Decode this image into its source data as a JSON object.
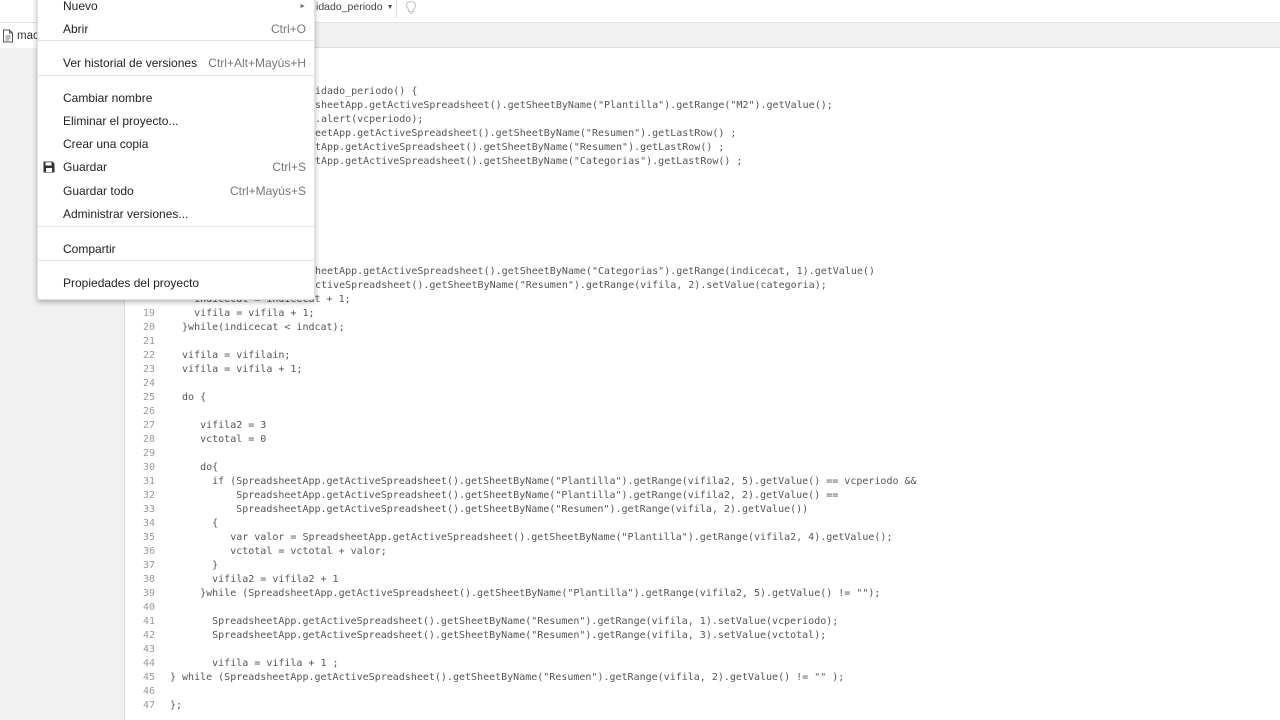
{
  "toolbar": {
    "function_selector": "idado_periodo",
    "bulb_icon": "lightbulb-icon"
  },
  "file_tab": {
    "icon": "document-icon",
    "name": "mac"
  },
  "file_menu": {
    "items": [
      {
        "label": "Nuevo",
        "shortcut": "►"
      },
      {
        "label": "Abrir",
        "shortcut": "Ctrl+O"
      },
      {
        "label": "Ver historial de versiones",
        "shortcut": "Ctrl+Alt+Mayús+H"
      },
      {
        "label": "Cambiar nombre",
        "shortcut": ""
      },
      {
        "label": "Eliminar el proyecto...",
        "shortcut": ""
      },
      {
        "label": "Crear una copia",
        "shortcut": ""
      },
      {
        "label": "Guardar",
        "shortcut": "Ctrl+S",
        "icon": "save-icon"
      },
      {
        "label": "Guardar todo",
        "shortcut": "Ctrl+Mayús+S"
      },
      {
        "label": "Administrar versiones...",
        "shortcut": ""
      },
      {
        "label": "Compartir",
        "shortcut": ""
      },
      {
        "label": "Propiedades del proyecto",
        "shortcut": ""
      }
    ]
  },
  "code_lines": [
    {
      "num": "",
      "text": "idado_periodo() {"
    },
    {
      "num": "",
      "text": "sheetApp.getActiveSpreadsheet().getSheetByName(\"Plantilla\").getRange(\"M2\").getValue();"
    },
    {
      "num": "",
      "text": ".alert(vcperiodo);"
    },
    {
      "num": "",
      "text": "eetApp.getActiveSpreadsheet().getSheetByName(\"Resumen\").getLastRow() ;"
    },
    {
      "num": "",
      "text": "tApp.getActiveSpreadsheet().getSheetByName(\"Resumen\").getLastRow() ;"
    },
    {
      "num": "",
      "text": "tApp.getActiveSpreadsheet().getSheetByName(\"Categorias\").getLastRow() ;"
    },
    {
      "num": "",
      "text": "heetApp.getActiveSpreadsheet().getSheetByName(\"Categorias\").getRange(indicecat, 1).getValue()"
    },
    {
      "num": "",
      "text": "ctiveSpreadsheet().getSheetByName(\"Resumen\").getRange(vifila, 2).setValue(categoria);"
    },
    {
      "num": "",
      "text": "    indicecat = indicecat + 1;"
    },
    {
      "num": "19",
      "text": "    vifila = vifila + 1;"
    },
    {
      "num": "20",
      "text": "  }while(indicecat < indcat);"
    },
    {
      "num": "21",
      "text": ""
    },
    {
      "num": "22",
      "text": "  vifila = vifilain;"
    },
    {
      "num": "23",
      "text": "  vifila = vifila + 1;"
    },
    {
      "num": "24",
      "text": ""
    },
    {
      "num": "25",
      "text": "  do {"
    },
    {
      "num": "26",
      "text": ""
    },
    {
      "num": "27",
      "text": "     vifila2 = 3"
    },
    {
      "num": "28",
      "text": "     vctotal = 0"
    },
    {
      "num": "29",
      "text": ""
    },
    {
      "num": "30",
      "text": "     do{"
    },
    {
      "num": "31",
      "text": "       if (SpreadsheetApp.getActiveSpreadsheet().getSheetByName(\"Plantilla\").getRange(vifila2, 5).getValue() == vcperiodo &&"
    },
    {
      "num": "32",
      "text": "           SpreadsheetApp.getActiveSpreadsheet().getSheetByName(\"Plantilla\").getRange(vifila2, 2).getValue() =="
    },
    {
      "num": "33",
      "text": "           SpreadsheetApp.getActiveSpreadsheet().getSheetByName(\"Resumen\").getRange(vifila, 2).getValue())"
    },
    {
      "num": "34",
      "text": "       {"
    },
    {
      "num": "35",
      "text": "          var valor = SpreadsheetApp.getActiveSpreadsheet().getSheetByName(\"Plantilla\").getRange(vifila2, 4).getValue();"
    },
    {
      "num": "36",
      "text": "          vctotal = vctotal + valor;"
    },
    {
      "num": "37",
      "text": "       }"
    },
    {
      "num": "38",
      "text": "       vifila2 = vifila2 + 1"
    },
    {
      "num": "39",
      "text": "     }while (SpreadsheetApp.getActiveSpreadsheet().getSheetByName(\"Plantilla\").getRange(vifila2, 5).getValue() != \"\");"
    },
    {
      "num": "40",
      "text": ""
    },
    {
      "num": "41",
      "text": "       SpreadsheetApp.getActiveSpreadsheet().getSheetByName(\"Resumen\").getRange(vifila, 1).setValue(vcperiodo);"
    },
    {
      "num": "42",
      "text": "       SpreadsheetApp.getActiveSpreadsheet().getSheetByName(\"Resumen\").getRange(vifila, 3).setValue(vctotal);"
    },
    {
      "num": "43",
      "text": ""
    },
    {
      "num": "44",
      "text": "       vifila = vifila + 1 ;"
    },
    {
      "num": "45",
      "text": "} while (SpreadsheetApp.getActiveSpreadsheet().getSheetByName(\"Resumen\").getRange(vifila, 2).getValue() != \"\" );"
    },
    {
      "num": "46",
      "text": ""
    },
    {
      "num": "47",
      "text": "};"
    }
  ]
}
